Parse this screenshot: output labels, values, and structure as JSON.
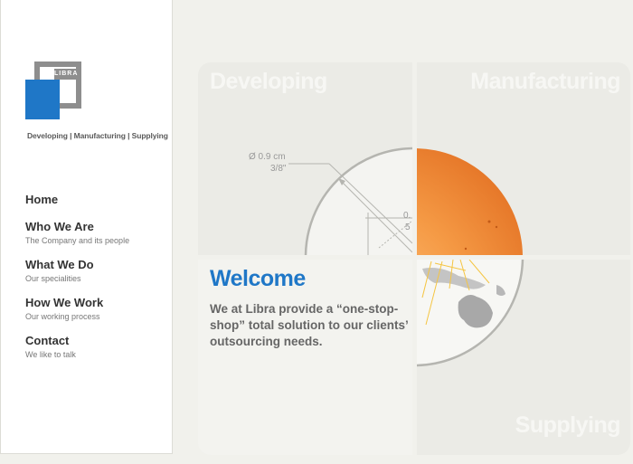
{
  "brand": {
    "logo_text": "LIBRA",
    "tagline": "Developing | Manufacturing | Supplying",
    "colors": {
      "blue": "#1f77c7",
      "grey": "#8e8e8e"
    }
  },
  "nav": {
    "items": [
      {
        "label": "Home",
        "sub": ""
      },
      {
        "label": "Who We Are",
        "sub": "The Company and its people"
      },
      {
        "label": "What We Do",
        "sub": "Our specialities"
      },
      {
        "label": "How We Work",
        "sub": "Our working process"
      },
      {
        "label": "Contact",
        "sub": "We like to talk"
      }
    ]
  },
  "panels": {
    "developing": "Developing",
    "manufacturing": "Manufacturing",
    "supplying": "Supplying"
  },
  "drawing": {
    "dim_diameter": "Ø 0.9 cm",
    "dim_inch": "3/8\"",
    "dim_small_a": "0.",
    "dim_small_b": "5"
  },
  "content": {
    "heading": "Welcome",
    "intro": "We at Libra provide a “one-stop-shop” total solution to our clients’ outsourcing needs."
  }
}
